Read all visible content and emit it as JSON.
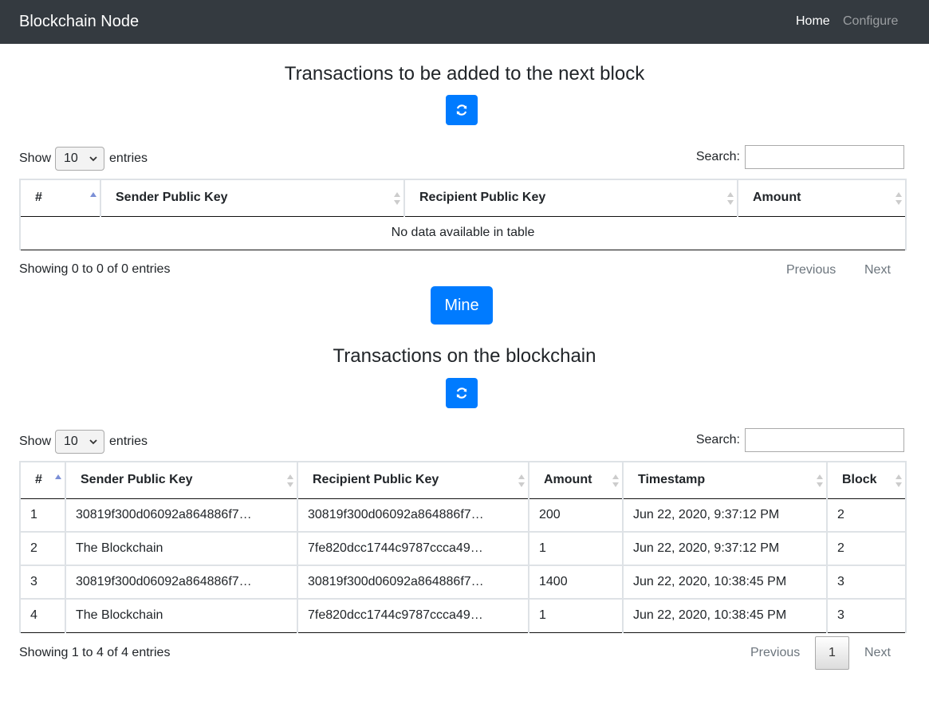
{
  "navbar": {
    "brand": "Blockchain Node",
    "home_label": "Home",
    "configure_label": "Configure"
  },
  "pending": {
    "title": "Transactions to be added to the next block",
    "show_label": "Show",
    "page_size": "10",
    "entries_label": "entries",
    "search_label": "Search:",
    "search_value": "",
    "columns": [
      "#",
      "Sender Public Key",
      "Recipient Public Key",
      "Amount"
    ],
    "empty_message": "No data available in table",
    "info": "Showing 0 to 0 of 0 entries",
    "previous_label": "Previous",
    "next_label": "Next"
  },
  "mine_label": "Mine",
  "chain": {
    "title": "Transactions on the blockchain",
    "show_label": "Show",
    "page_size": "10",
    "entries_label": "entries",
    "search_label": "Search:",
    "search_value": "",
    "columns": [
      "#",
      "Sender Public Key",
      "Recipient Public Key",
      "Amount",
      "Timestamp",
      "Block"
    ],
    "rows": [
      {
        "num": "1",
        "sender": "30819f300d06092a864886f7…",
        "recipient": "30819f300d06092a864886f7…",
        "amount": "200",
        "timestamp": "Jun 22, 2020, 9:37:12 PM",
        "block": "2"
      },
      {
        "num": "2",
        "sender": "The Blockchain",
        "recipient": "7fe820dcc1744c9787ccca49…",
        "amount": "1",
        "timestamp": "Jun 22, 2020, 9:37:12 PM",
        "block": "2"
      },
      {
        "num": "3",
        "sender": "30819f300d06092a864886f7…",
        "recipient": "30819f300d06092a864886f7…",
        "amount": "1400",
        "timestamp": "Jun 22, 2020, 10:38:45 PM",
        "block": "3"
      },
      {
        "num": "4",
        "sender": "The Blockchain",
        "recipient": "7fe820dcc1744c9787ccca49…",
        "amount": "1",
        "timestamp": "Jun 22, 2020, 10:38:45 PM",
        "block": "3"
      }
    ],
    "info": "Showing 1 to 4 of 4 entries",
    "previous_label": "Previous",
    "current_page": "1",
    "next_label": "Next"
  },
  "icons": {
    "refresh": "refresh-icon",
    "sort": "sort-icon",
    "dropdown": "chevron-down-icon"
  },
  "colors": {
    "navbar": "#343a40",
    "primary": "#007bff",
    "sort_active": "#7b8fd6",
    "sort_inactive": "#cccccc"
  }
}
